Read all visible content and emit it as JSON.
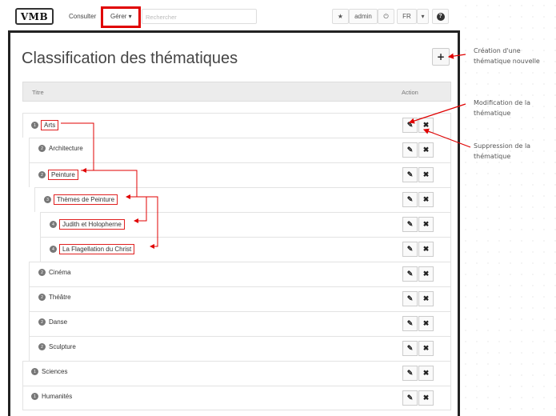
{
  "navbar": {
    "logo": "VMB",
    "consulter": "Consulter",
    "gerer": "Gérer ▾",
    "search_placeholder": "Rechercher",
    "user": "admin",
    "lang": "FR",
    "lang_caret": "▾"
  },
  "page": {
    "title": "Classification des thématiques",
    "add_label": "+"
  },
  "table": {
    "col_title": "Titre",
    "col_action": "Action"
  },
  "rows": [
    {
      "label": "Arts",
      "badge": "1"
    },
    {
      "label": "Architecture",
      "badge": "2"
    },
    {
      "label": "Peinture",
      "badge": "2"
    },
    {
      "label": "Thèmes de Peinture",
      "badge": "3"
    },
    {
      "label": "Judith et Holopherne",
      "badge": "4"
    },
    {
      "label": "La Flagellation du Christ",
      "badge": "4"
    },
    {
      "label": "Cinéma",
      "badge": "2"
    },
    {
      "label": "Théâtre",
      "badge": "2"
    },
    {
      "label": "Danse",
      "badge": "2"
    },
    {
      "label": "Sculpture",
      "badge": "2"
    },
    {
      "label": "Sciences",
      "badge": "1"
    },
    {
      "label": "Humanités",
      "badge": "1"
    }
  ],
  "actions": {
    "edit_icon": "pencil-icon",
    "delete_icon": "cross-icon"
  },
  "annotations": {
    "add": "Création d'une\nthématique nouvelle",
    "edit": "Modification de la\nthématique",
    "delete": "Suppression de la\nthématique"
  }
}
